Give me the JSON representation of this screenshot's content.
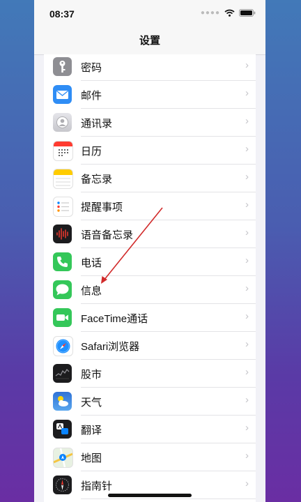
{
  "status": {
    "time": "08:37"
  },
  "header": {
    "title": "设置"
  },
  "chevron": "›",
  "list": {
    "items": [
      {
        "label": "密码",
        "icon": "key-icon",
        "color": "#8e8e93"
      },
      {
        "label": "邮件",
        "icon": "mail-icon",
        "color": "#2f8df5"
      },
      {
        "label": "通讯录",
        "icon": "contacts-icon",
        "color": "#c7c7cc"
      },
      {
        "label": "日历",
        "icon": "calendar-icon",
        "color": "#ffffff"
      },
      {
        "label": "备忘录",
        "icon": "notes-icon",
        "color": "#ffffff"
      },
      {
        "label": "提醒事项",
        "icon": "reminders-icon",
        "color": "#ffffff"
      },
      {
        "label": "语音备忘录",
        "icon": "voice-memos-icon",
        "color": "#1c1c1e"
      },
      {
        "label": "电话",
        "icon": "phone-icon",
        "color": "#34c759"
      },
      {
        "label": "信息",
        "icon": "messages-icon",
        "color": "#34c759"
      },
      {
        "label": "FaceTime通话",
        "icon": "facetime-icon",
        "color": "#34c759"
      },
      {
        "label": "Safari浏览器",
        "icon": "safari-icon",
        "color": "#ffffff"
      },
      {
        "label": "股市",
        "icon": "stocks-icon",
        "color": "#1c1c1e"
      },
      {
        "label": "天气",
        "icon": "weather-icon",
        "color": "#3a86e0"
      },
      {
        "label": "翻译",
        "icon": "translate-icon",
        "color": "#1c1c1e"
      },
      {
        "label": "地图",
        "icon": "maps-icon",
        "color": "#e8f1e2"
      },
      {
        "label": "指南针",
        "icon": "compass-icon",
        "color": "#1c1c1e"
      }
    ]
  },
  "annotation": {
    "color": "#d12a2a"
  }
}
